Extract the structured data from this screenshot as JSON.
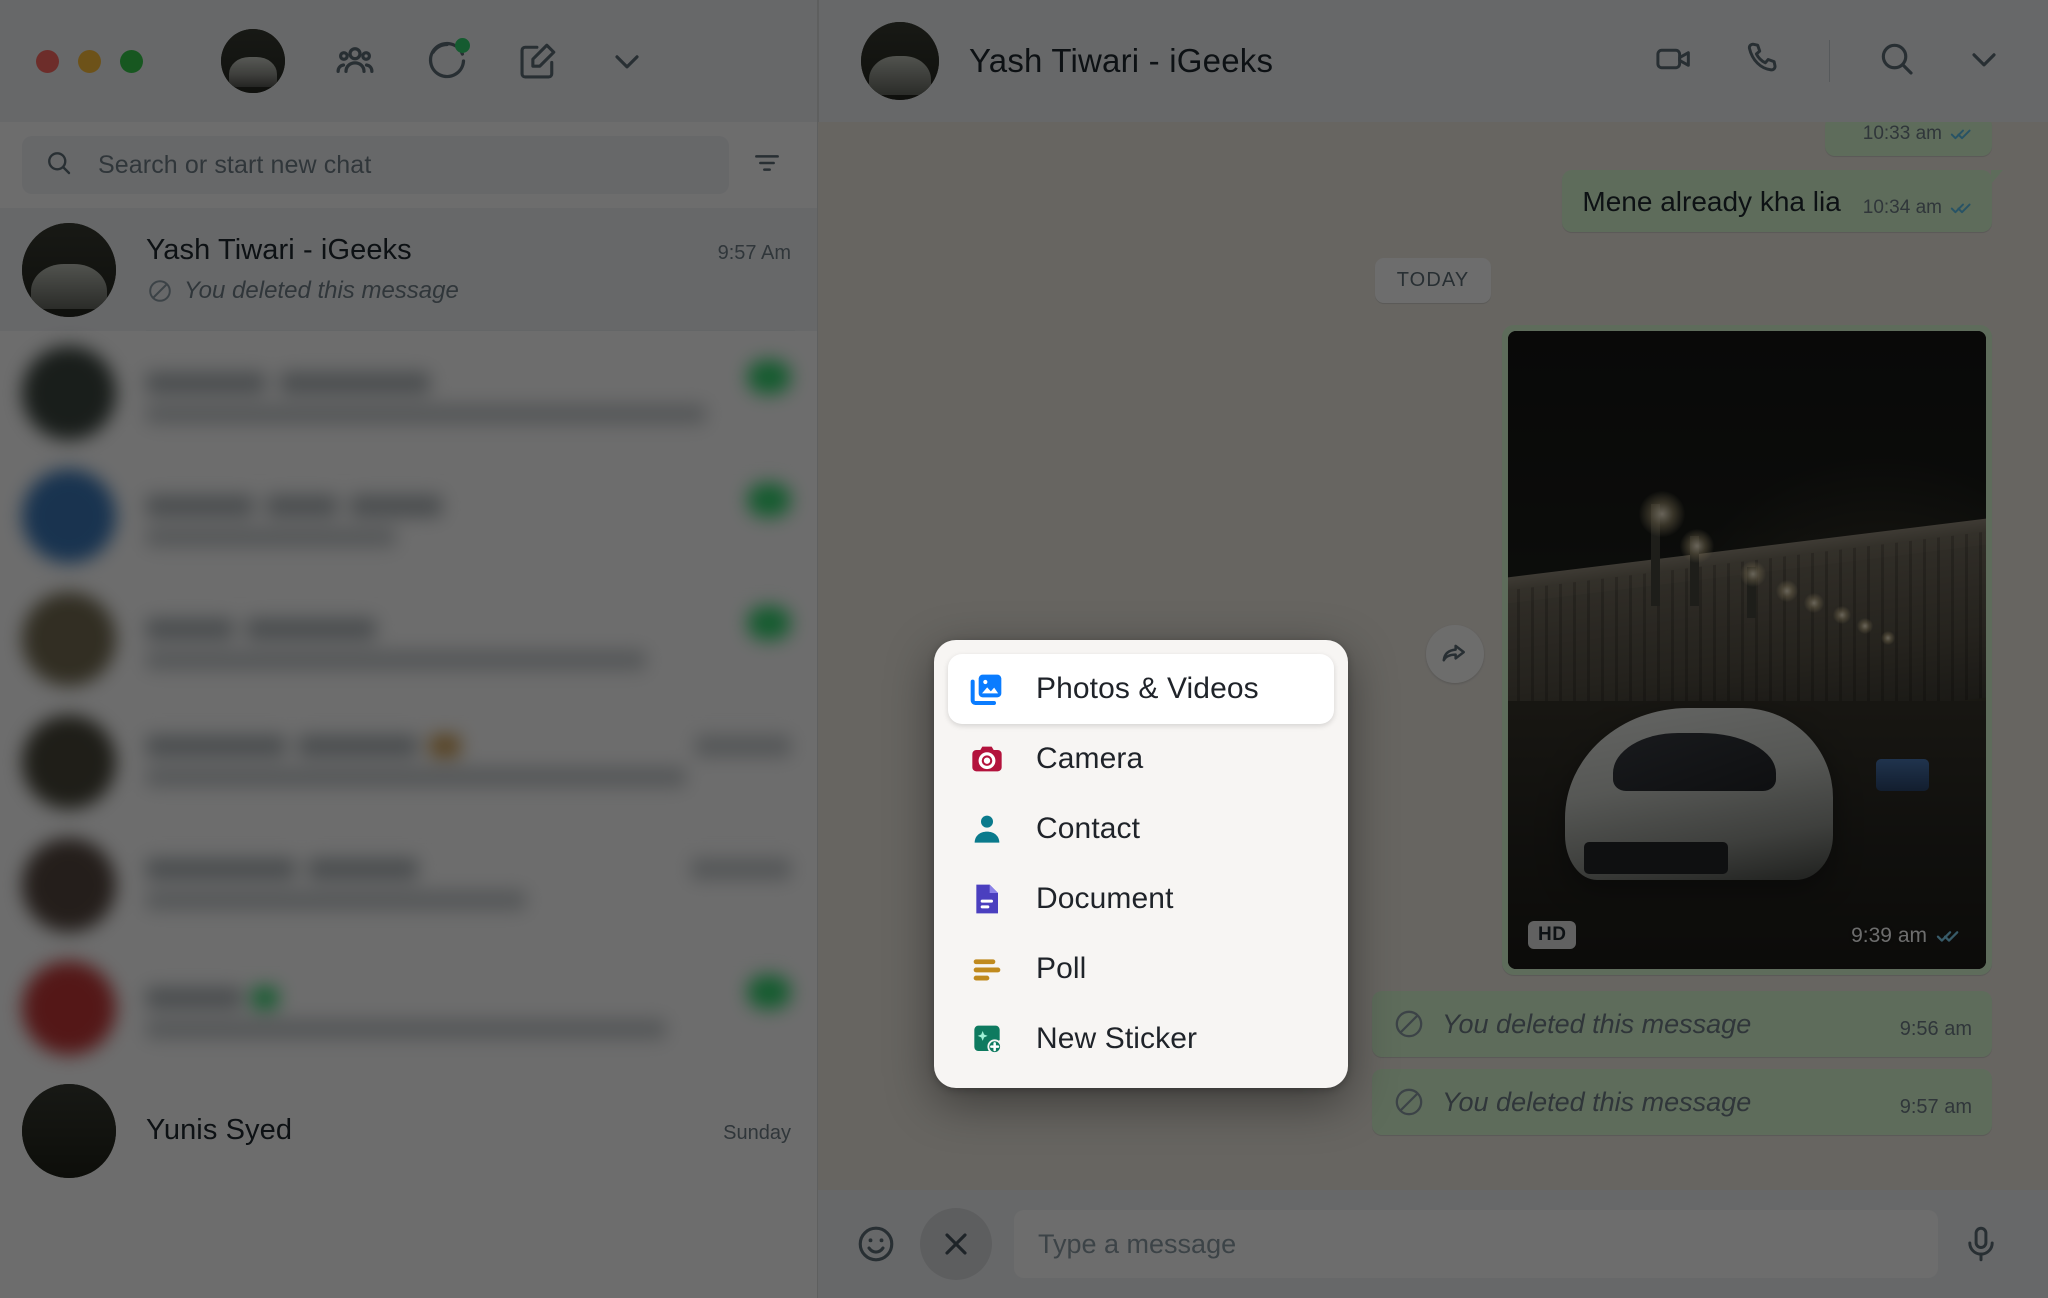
{
  "window": {
    "traffic_lights": [
      "close",
      "minimize",
      "zoom"
    ],
    "colors": {
      "accent_green": "#25d366",
      "bubble_out": "#d9fdd3",
      "panel_bg": "#f0f2f5",
      "convo_bg": "#efeae2",
      "tick_blue": "#53bdeb"
    }
  },
  "sidebar": {
    "toolbar": {
      "avatar_name": "my-profile-avatar",
      "icons": [
        {
          "name": "communities-icon",
          "label": "Communities"
        },
        {
          "name": "status-icon",
          "label": "Status"
        },
        {
          "name": "new-chat-icon",
          "label": "New chat"
        },
        {
          "name": "chevron-down-icon",
          "label": "Menu"
        }
      ]
    },
    "search": {
      "placeholder": "Search or start new chat",
      "icon": "search-icon",
      "filter_icon": "filter-icon"
    },
    "chats": [
      {
        "name": "Yash Tiwari - iGeeks",
        "time": "9:57 Am",
        "preview": "You deleted this message",
        "preview_icon": "blocked-icon",
        "active": true,
        "blurred": false
      },
      {
        "name": "",
        "time": "",
        "preview": "",
        "active": false,
        "blurred": true,
        "avatar_color": "#2f3a33",
        "badge": true
      },
      {
        "name": "",
        "time": "",
        "preview": "",
        "active": false,
        "blurred": true,
        "avatar_color": "#2d6fb5",
        "badge": true
      },
      {
        "name": "",
        "time": "",
        "preview": "",
        "active": false,
        "blurred": true,
        "avatar_color": "#6b6246",
        "badge": true
      },
      {
        "name": "",
        "time": "",
        "preview": "",
        "active": false,
        "blurred": true,
        "avatar_color": "#3c3a2c",
        "badge": false
      },
      {
        "name": "",
        "time": "",
        "preview": "",
        "active": false,
        "blurred": true,
        "avatar_color": "#4a3b33",
        "badge": false
      },
      {
        "name": "",
        "time": "",
        "preview": "",
        "active": false,
        "blurred": true,
        "avatar_color": "#c02a2a",
        "badge": true
      },
      {
        "name": "Yunis Syed",
        "time": "Sunday",
        "preview": "",
        "active": false,
        "blurred": false
      }
    ]
  },
  "chat": {
    "header": {
      "title": "Yash Tiwari - iGeeks",
      "actions": [
        {
          "name": "video-call-icon",
          "label": "Video call"
        },
        {
          "name": "voice-call-icon",
          "label": "Voice call"
        },
        {
          "name": "search-icon",
          "label": "Search"
        },
        {
          "name": "chevron-down-icon",
          "label": "Menu"
        }
      ]
    },
    "day_separator": "TODAY",
    "messages": [
      {
        "kind": "text-partial",
        "text": "",
        "time": "10:33 am",
        "status": "read"
      },
      {
        "kind": "text",
        "text": "Mene already kha lia",
        "time": "10:34 am",
        "status": "read"
      },
      {
        "kind": "image",
        "badge": "HD",
        "time": "9:39 am",
        "status": "read",
        "forward_icon": "forward-icon"
      },
      {
        "kind": "deleted",
        "text": "You deleted this message",
        "time": "9:56 am",
        "icon": "blocked-icon"
      },
      {
        "kind": "deleted",
        "text": "You deleted this message",
        "time": "9:57 am",
        "icon": "blocked-icon"
      }
    ],
    "composer": {
      "emoji_icon": "emoji-icon",
      "close_attach_icon": "close-icon",
      "placeholder": "Type a message",
      "mic_icon": "microphone-icon"
    }
  },
  "attachment_menu": {
    "items": [
      {
        "label": "Photos & Videos",
        "icon": "photos-videos-icon",
        "color": "#0a7cff",
        "selected": true
      },
      {
        "label": "Camera",
        "icon": "camera-icon",
        "color": "#b3123c",
        "selected": false
      },
      {
        "label": "Contact",
        "icon": "contact-icon",
        "color": "#0a7a8c",
        "selected": false
      },
      {
        "label": "Document",
        "icon": "document-icon",
        "color": "#4b3fbf",
        "selected": false
      },
      {
        "label": "Poll",
        "icon": "poll-icon",
        "color": "#c08a1e",
        "selected": false
      },
      {
        "label": "New Sticker",
        "icon": "new-sticker-icon",
        "color": "#0e7a5f",
        "selected": false
      }
    ]
  }
}
